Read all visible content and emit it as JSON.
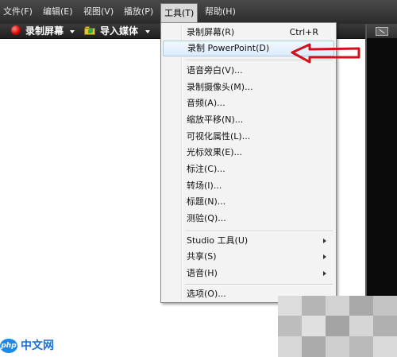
{
  "menubar": {
    "items": [
      {
        "label": "文件(F)"
      },
      {
        "label": "编辑(E)"
      },
      {
        "label": "视图(V)"
      },
      {
        "label": "播放(P)"
      },
      {
        "label": "工具(T)"
      },
      {
        "label": "帮助(H)"
      }
    ]
  },
  "toolbar": {
    "record_screen_label": "录制屏幕",
    "import_media_label": "导入媒体"
  },
  "tools_menu": {
    "items": [
      {
        "label": "录制屏幕(R)",
        "shortcut": "Ctrl+R"
      },
      {
        "label": "录制 PowerPoint(D)"
      },
      {
        "label": "语音旁白(V)..."
      },
      {
        "label": "录制摄像头(M)..."
      },
      {
        "label": "音频(A)..."
      },
      {
        "label": "缩放平移(N)..."
      },
      {
        "label": "可视化属性(L)..."
      },
      {
        "label": "光标效果(E)..."
      },
      {
        "label": "标注(C)..."
      },
      {
        "label": "转场(I)..."
      },
      {
        "label": "标题(N)..."
      },
      {
        "label": "测验(Q)..."
      },
      {
        "label": "Studio 工具(U)"
      },
      {
        "label": "共享(S)"
      },
      {
        "label": "语音(H)"
      },
      {
        "label": "选项(O)..."
      }
    ]
  },
  "watermark": {
    "logo": "php",
    "text": "中文网"
  },
  "colors": {
    "menubar_bg": "#2f2f2f",
    "menu_bg": "#f3f3f3",
    "highlight_border": "#a8c8ea",
    "annotation_arrow": "#d0101a",
    "watermark_blue": "#1e6fd6"
  }
}
